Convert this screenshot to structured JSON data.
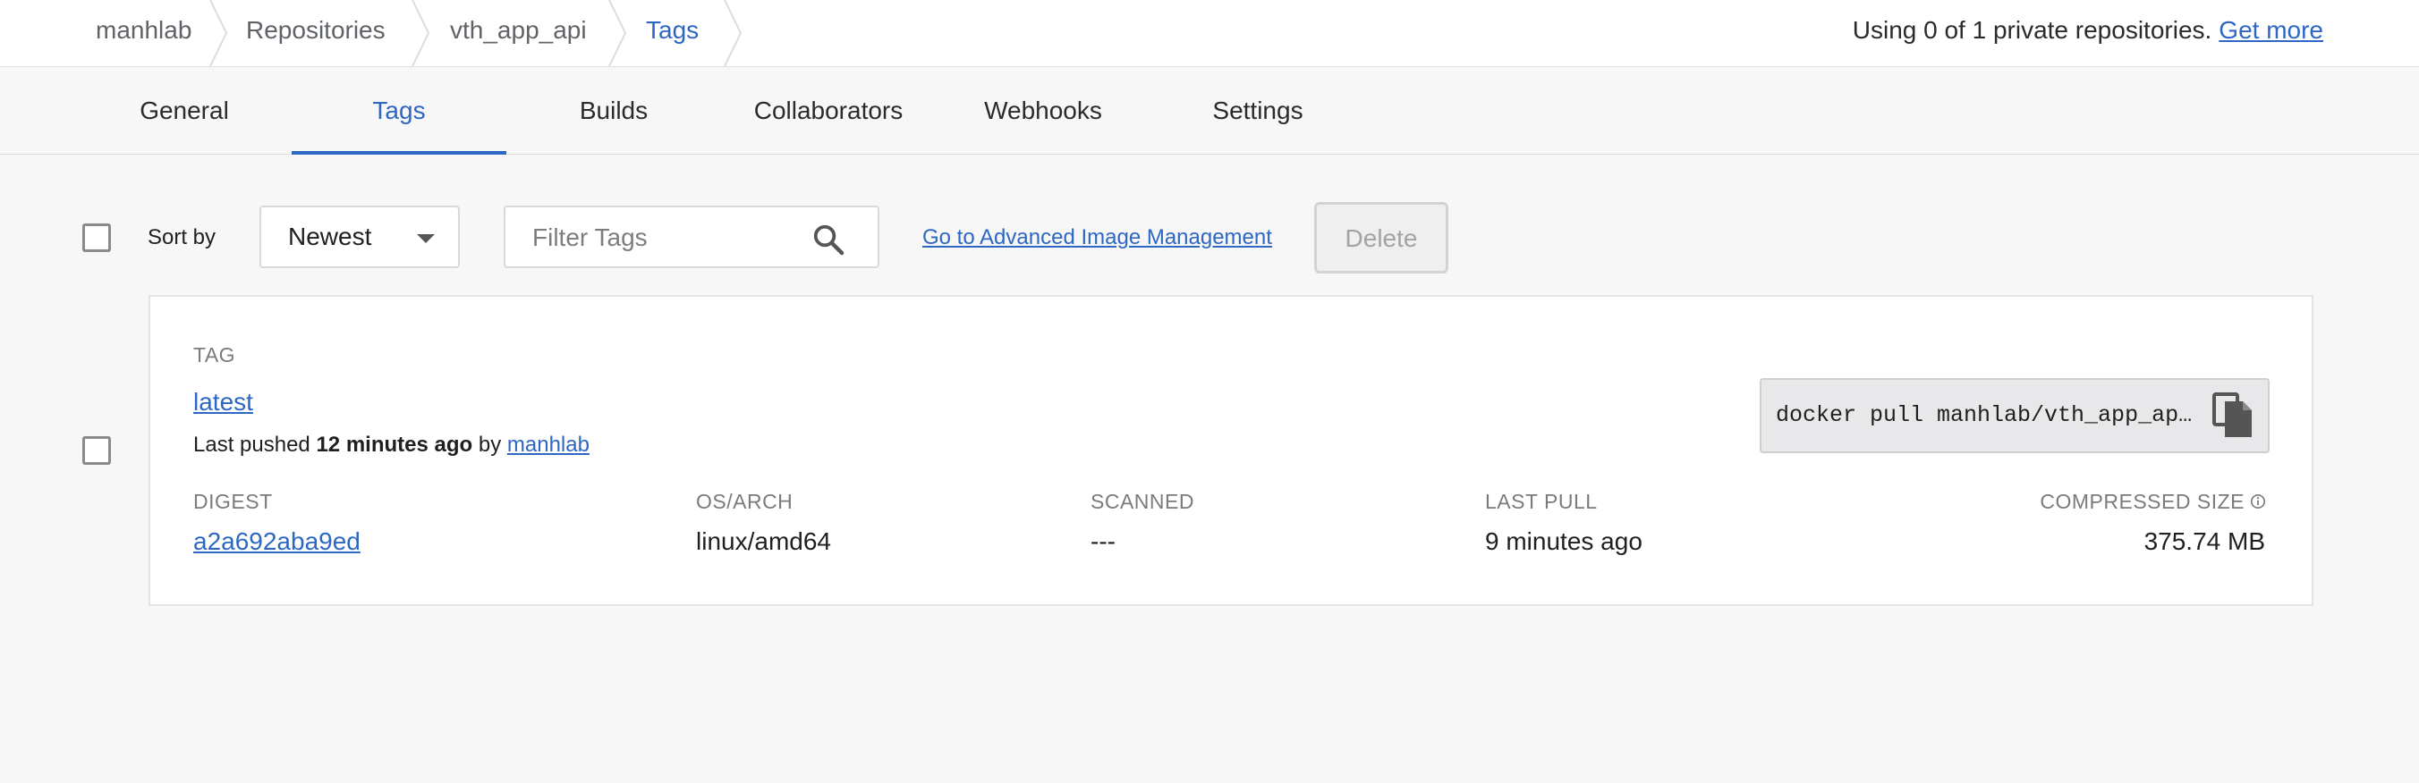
{
  "breadcrumb": {
    "items": [
      {
        "label": "manhlab"
      },
      {
        "label": "Repositories"
      },
      {
        "label": "vth_app_api"
      },
      {
        "label": "Tags"
      }
    ]
  },
  "usage": {
    "text": "Using 0 of 1 private repositories.",
    "link_label": "Get more"
  },
  "tabs": [
    {
      "label": "General"
    },
    {
      "label": "Tags"
    },
    {
      "label": "Builds"
    },
    {
      "label": "Collaborators"
    },
    {
      "label": "Webhooks"
    },
    {
      "label": "Settings"
    }
  ],
  "tabs_active": "Tags",
  "toolbar": {
    "sort_label": "Sort by",
    "sort_value": "Newest",
    "filter_placeholder": "Filter Tags",
    "advanced_link": "Go to Advanced Image Management",
    "delete_label": "Delete"
  },
  "tag_card": {
    "tag_heading": "TAG",
    "tag_name": "latest",
    "pushed_prefix": "Last pushed",
    "pushed_time": "12 minutes ago",
    "pushed_by_word": "by",
    "pushed_by_user": "manhlab",
    "pull_command": "docker pull manhlab/vth_app_api:latest",
    "columns": {
      "digest_label": "DIGEST",
      "digest_value": "a2a692aba9ed",
      "os_label": "OS/ARCH",
      "os_value": "linux/amd64",
      "scanned_label": "SCANNED",
      "scanned_value": "---",
      "last_pull_label": "LAST PULL",
      "last_pull_value": "9 minutes ago",
      "size_label": "COMPRESSED SIZE",
      "size_value": "375.74 MB"
    }
  },
  "icons": {
    "search": "search-icon",
    "copy": "copy-icon",
    "info": "info-icon",
    "dropdown": "chevron-down-icon"
  },
  "colors": {
    "accent": "#2d67c4",
    "background": "#f7f7f7",
    "card": "#ffffff"
  }
}
